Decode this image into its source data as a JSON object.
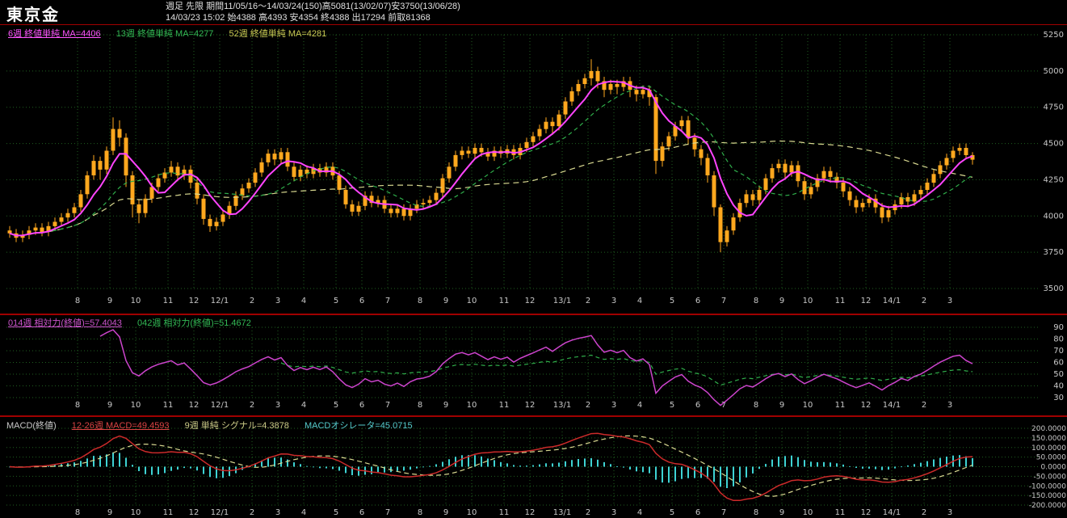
{
  "header": {
    "title": "東京金",
    "info_line1": "週足 先限 期間11/05/16～14/03/24(150)高5081(13/02/07)安3750(13/06/28)",
    "info_line2": "14/03/23 15:02 始4388 高4393 安4354 終4388 出17294 前取81368"
  },
  "main_chart": {
    "ma_labels": [
      {
        "text": "6週 終値単純 MA=4406",
        "color": "#ff55ff"
      },
      {
        "text": "13週 終値単純 MA=4277",
        "color": "#33bb55"
      },
      {
        "text": "52週 終値単純 MA=4281",
        "color": "#cccc55"
      }
    ]
  },
  "rsi_panel": {
    "labels": [
      {
        "text": "014週 相対力(終値)=57.4043",
        "color": "#cc55cc"
      },
      {
        "text": "042週 相対力(終値)=51.4672",
        "color": "#33bb55"
      }
    ]
  },
  "macd_panel": {
    "labels": [
      {
        "text": "MACD(終値)",
        "color": "#c8c8c8"
      },
      {
        "text": "12-26週 MACD=49.4593",
        "color": "#dd4444"
      },
      {
        "text": "9週 単純 シグナル=4.3878",
        "color": "#cccc88"
      },
      {
        "text": "MACDオシレータ=45.0715",
        "color": "#55cccc"
      }
    ]
  },
  "colors": {
    "background": "#000000",
    "grid": "#1f5f1f",
    "candle": "#ffa81e",
    "ma6": "#ff44ff",
    "ma13": "#2fae4a",
    "ma52": "#d8d890",
    "rsi14": "#cc44cc",
    "rsi42": "#2fae4a",
    "macd_line": "#cc2a2a",
    "macd_signal": "#d8d890",
    "macd_hist": "#3ed3d3",
    "panel_border": "#a00000",
    "axis_text": "#c8c8c8",
    "header_text": "#e0e0e0",
    "title_text": "#ffffff"
  },
  "chart_data": {
    "type": "candlestick",
    "title": "東京金 週足 (Tokyo Gold weekly)",
    "period_label": "11/05/16～14/03/24",
    "num_weeks": 150,
    "high_of_period": {
      "value": 5081,
      "date": "13/02/07"
    },
    "low_of_period": {
      "value": 3750,
      "date": "13/06/28"
    },
    "x_labels": [
      {
        "label": "8",
        "week": 11
      },
      {
        "label": "9",
        "week": 16
      },
      {
        "label": "10",
        "week": 20
      },
      {
        "label": "11",
        "week": 25
      },
      {
        "label": "12",
        "week": 29
      },
      {
        "label": "12/1",
        "week": 33
      },
      {
        "label": "2",
        "week": 38
      },
      {
        "label": "3",
        "week": 42
      },
      {
        "label": "4",
        "week": 46
      },
      {
        "label": "5",
        "week": 51
      },
      {
        "label": "6",
        "week": 55
      },
      {
        "label": "7",
        "week": 59
      },
      {
        "label": "8",
        "week": 64
      },
      {
        "label": "9",
        "week": 68
      },
      {
        "label": "10",
        "week": 72
      },
      {
        "label": "11",
        "week": 77
      },
      {
        "label": "12",
        "week": 81
      },
      {
        "label": "13/1",
        "week": 86
      },
      {
        "label": "2",
        "week": 90
      },
      {
        "label": "3",
        "week": 94
      },
      {
        "label": "4",
        "week": 98
      },
      {
        "label": "5",
        "week": 103
      },
      {
        "label": "6",
        "week": 107
      },
      {
        "label": "7",
        "week": 111
      },
      {
        "label": "8",
        "week": 116
      },
      {
        "label": "9",
        "week": 120
      },
      {
        "label": "10",
        "week": 124
      },
      {
        "label": "11",
        "week": 129
      },
      {
        "label": "12",
        "week": 133
      },
      {
        "label": "14/1",
        "week": 137
      },
      {
        "label": "2",
        "week": 142
      },
      {
        "label": "3",
        "week": 146
      }
    ],
    "price": {
      "ylim": [
        3500,
        5250
      ],
      "ticks": [
        "5250",
        "5000",
        "4750",
        "4500",
        "4250",
        "4000",
        "3750",
        "3500"
      ],
      "ma_periods": [
        6,
        13,
        52
      ],
      "candles": [
        [
          3900,
          3930,
          3850,
          3880
        ],
        [
          3880,
          3910,
          3820,
          3850
        ],
        [
          3850,
          3900,
          3820,
          3870
        ],
        [
          3870,
          3930,
          3840,
          3900
        ],
        [
          3900,
          3950,
          3870,
          3920
        ],
        [
          3920,
          3950,
          3860,
          3890
        ],
        [
          3890,
          3960,
          3860,
          3930
        ],
        [
          3930,
          3990,
          3900,
          3960
        ],
        [
          3960,
          4020,
          3930,
          3990
        ],
        [
          3990,
          4050,
          3960,
          4020
        ],
        [
          4020,
          4090,
          3990,
          4060
        ],
        [
          4060,
          4180,
          4030,
          4150
        ],
        [
          4150,
          4310,
          4120,
          4280
        ],
        [
          4280,
          4420,
          4250,
          4380
        ],
        [
          4380,
          4410,
          4250,
          4320
        ],
        [
          4320,
          4480,
          4290,
          4450
        ],
        [
          4450,
          4680,
          4420,
          4600
        ],
        [
          4600,
          4660,
          4480,
          4540
        ],
        [
          4540,
          4570,
          4200,
          4280
        ],
        [
          4280,
          4310,
          3990,
          4080
        ],
        [
          4080,
          4110,
          3950,
          4020
        ],
        [
          4020,
          4150,
          3990,
          4120
        ],
        [
          4120,
          4230,
          4090,
          4200
        ],
        [
          4200,
          4290,
          4170,
          4260
        ],
        [
          4260,
          4330,
          4230,
          4300
        ],
        [
          4300,
          4380,
          4270,
          4340
        ],
        [
          4340,
          4370,
          4240,
          4280
        ],
        [
          4280,
          4350,
          4250,
          4320
        ],
        [
          4320,
          4350,
          4190,
          4230
        ],
        [
          4230,
          4260,
          4080,
          4120
        ],
        [
          4120,
          4150,
          3940,
          3980
        ],
        [
          3980,
          4010,
          3890,
          3930
        ],
        [
          3930,
          3990,
          3900,
          3960
        ],
        [
          3960,
          4040,
          3930,
          4010
        ],
        [
          4010,
          4100,
          3980,
          4070
        ],
        [
          4070,
          4170,
          4040,
          4140
        ],
        [
          4140,
          4220,
          4110,
          4190
        ],
        [
          4190,
          4260,
          4160,
          4230
        ],
        [
          4230,
          4330,
          4200,
          4300
        ],
        [
          4300,
          4400,
          4270,
          4370
        ],
        [
          4370,
          4460,
          4340,
          4430
        ],
        [
          4430,
          4460,
          4350,
          4390
        ],
        [
          4390,
          4470,
          4360,
          4440
        ],
        [
          4440,
          4470,
          4310,
          4340
        ],
        [
          4340,
          4370,
          4240,
          4270
        ],
        [
          4270,
          4350,
          4240,
          4320
        ],
        [
          4320,
          4350,
          4260,
          4290
        ],
        [
          4290,
          4360,
          4260,
          4330
        ],
        [
          4330,
          4360,
          4270,
          4300
        ],
        [
          4300,
          4370,
          4270,
          4340
        ],
        [
          4340,
          4370,
          4250,
          4280
        ],
        [
          4280,
          4310,
          4150,
          4180
        ],
        [
          4180,
          4210,
          4050,
          4080
        ],
        [
          4080,
          4110,
          4000,
          4030
        ],
        [
          4030,
          4100,
          4000,
          4070
        ],
        [
          4070,
          4170,
          4040,
          4140
        ],
        [
          4140,
          4170,
          4060,
          4090
        ],
        [
          4090,
          4140,
          4060,
          4110
        ],
        [
          4110,
          4140,
          4020,
          4050
        ],
        [
          4050,
          4080,
          3990,
          4020
        ],
        [
          4020,
          4080,
          3990,
          4050
        ],
        [
          4050,
          4080,
          3970,
          4000
        ],
        [
          4000,
          4080,
          3970,
          4050
        ],
        [
          4050,
          4110,
          4020,
          4080
        ],
        [
          4080,
          4120,
          4050,
          4090
        ],
        [
          4090,
          4140,
          4060,
          4110
        ],
        [
          4110,
          4190,
          4080,
          4160
        ],
        [
          4160,
          4290,
          4130,
          4260
        ],
        [
          4260,
          4370,
          4230,
          4340
        ],
        [
          4340,
          4450,
          4310,
          4420
        ],
        [
          4420,
          4480,
          4390,
          4450
        ],
        [
          4450,
          4480,
          4400,
          4430
        ],
        [
          4430,
          4500,
          4400,
          4470
        ],
        [
          4470,
          4500,
          4410,
          4440
        ],
        [
          4440,
          4470,
          4380,
          4410
        ],
        [
          4410,
          4480,
          4380,
          4450
        ],
        [
          4450,
          4480,
          4400,
          4430
        ],
        [
          4430,
          4490,
          4400,
          4460
        ],
        [
          4460,
          4490,
          4390,
          4420
        ],
        [
          4420,
          4500,
          4390,
          4470
        ],
        [
          4470,
          4540,
          4440,
          4510
        ],
        [
          4510,
          4580,
          4480,
          4550
        ],
        [
          4550,
          4630,
          4520,
          4600
        ],
        [
          4600,
          4680,
          4570,
          4650
        ],
        [
          4650,
          4680,
          4560,
          4620
        ],
        [
          4620,
          4730,
          4590,
          4700
        ],
        [
          4700,
          4820,
          4670,
          4790
        ],
        [
          4790,
          4890,
          4760,
          4860
        ],
        [
          4860,
          4940,
          4830,
          4910
        ],
        [
          4910,
          4980,
          4880,
          4950
        ],
        [
          4950,
          5081,
          4900,
          5000
        ],
        [
          5000,
          5030,
          4880,
          4930
        ],
        [
          4930,
          4960,
          4820,
          4870
        ],
        [
          4870,
          4940,
          4840,
          4910
        ],
        [
          4910,
          4940,
          4840,
          4890
        ],
        [
          4890,
          4960,
          4860,
          4930
        ],
        [
          4930,
          4960,
          4820,
          4870
        ],
        [
          4870,
          4900,
          4790,
          4840
        ],
        [
          4840,
          4900,
          4810,
          4870
        ],
        [
          4870,
          4900,
          4760,
          4820
        ],
        [
          4820,
          4840,
          4290,
          4380
        ],
        [
          4380,
          4510,
          4340,
          4480
        ],
        [
          4480,
          4580,
          4450,
          4550
        ],
        [
          4550,
          4650,
          4520,
          4620
        ],
        [
          4620,
          4690,
          4580,
          4660
        ],
        [
          4660,
          4690,
          4490,
          4540
        ],
        [
          4540,
          4570,
          4410,
          4460
        ],
        [
          4460,
          4490,
          4350,
          4400
        ],
        [
          4400,
          4430,
          4230,
          4280
        ],
        [
          4280,
          4310,
          4000,
          4060
        ],
        [
          4060,
          4080,
          3750,
          3820
        ],
        [
          3820,
          3930,
          3790,
          3900
        ],
        [
          3900,
          4020,
          3870,
          3990
        ],
        [
          3990,
          4120,
          3960,
          4090
        ],
        [
          4090,
          4180,
          4060,
          4150
        ],
        [
          4150,
          4180,
          4070,
          4110
        ],
        [
          4110,
          4210,
          4080,
          4180
        ],
        [
          4180,
          4290,
          4150,
          4260
        ],
        [
          4260,
          4360,
          4230,
          4330
        ],
        [
          4330,
          4390,
          4300,
          4360
        ],
        [
          4360,
          4390,
          4260,
          4300
        ],
        [
          4300,
          4380,
          4270,
          4350
        ],
        [
          4350,
          4380,
          4200,
          4240
        ],
        [
          4240,
          4270,
          4110,
          4150
        ],
        [
          4150,
          4230,
          4120,
          4200
        ],
        [
          4200,
          4290,
          4170,
          4260
        ],
        [
          4260,
          4340,
          4230,
          4310
        ],
        [
          4310,
          4340,
          4230,
          4270
        ],
        [
          4270,
          4300,
          4190,
          4230
        ],
        [
          4230,
          4260,
          4130,
          4170
        ],
        [
          4170,
          4200,
          4070,
          4110
        ],
        [
          4110,
          4140,
          4020,
          4060
        ],
        [
          4060,
          4120,
          4030,
          4090
        ],
        [
          4090,
          4150,
          4060,
          4120
        ],
        [
          4120,
          4150,
          4020,
          4060
        ],
        [
          4060,
          4090,
          3950,
          3990
        ],
        [
          3990,
          4070,
          3960,
          4040
        ],
        [
          4040,
          4110,
          4010,
          4080
        ],
        [
          4080,
          4160,
          4050,
          4130
        ],
        [
          4130,
          4160,
          4060,
          4100
        ],
        [
          4100,
          4180,
          4070,
          4150
        ],
        [
          4150,
          4210,
          4120,
          4180
        ],
        [
          4180,
          4260,
          4150,
          4230
        ],
        [
          4230,
          4320,
          4200,
          4290
        ],
        [
          4290,
          4380,
          4260,
          4350
        ],
        [
          4350,
          4430,
          4320,
          4400
        ],
        [
          4400,
          4480,
          4370,
          4450
        ],
        [
          4450,
          4500,
          4420,
          4470
        ],
        [
          4470,
          4500,
          4390,
          4420
        ],
        [
          4420,
          4440,
          4354,
          4388
        ]
      ]
    },
    "rsi": {
      "periods": [
        14,
        42
      ],
      "ylim": [
        30,
        90
      ],
      "ticks": [
        "90",
        "80",
        "70",
        "60",
        "50",
        "40",
        "30"
      ],
      "last_values": {
        "rsi14": 57.4043,
        "rsi42": 51.4672
      }
    },
    "macd": {
      "fast": 12,
      "slow": 26,
      "signal_period": 9,
      "ylim": [
        -200,
        200
      ],
      "ticks": [
        "200.0000",
        "150.0000",
        "100.0000",
        "50.0000",
        "0.0000",
        "-50.0000",
        "-100.0000",
        "-150.0000",
        "-200.0000"
      ],
      "last_values": {
        "macd": 49.4593,
        "signal": 4.3878,
        "oscillator": 45.0715
      }
    }
  }
}
